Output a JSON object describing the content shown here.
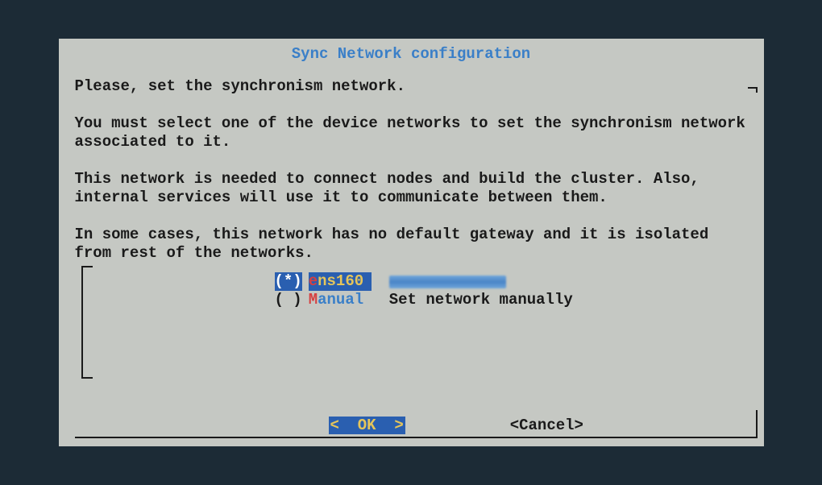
{
  "title": "Sync Network configuration",
  "paragraphs": {
    "p1": "Please, set the synchronism network.",
    "p2": "You must select one of the device networks to set the synchronism network associated to it.",
    "p3": "This network is needed to connect nodes and build the cluster. Also, internal services will use it to communicate between them.",
    "p4": "In some cases, this network has no default gateway and it is isolated from rest of the networks."
  },
  "options": {
    "opt1": {
      "radio": "(*)",
      "hotkey": "e",
      "rest": "ns160",
      "selected": true
    },
    "opt2": {
      "radio": "( )",
      "hotkey": "M",
      "rest": "anual",
      "desc": "Set network manually",
      "selected": false
    }
  },
  "buttons": {
    "ok": "<  OK  >",
    "cancel": "<Cancel>"
  }
}
